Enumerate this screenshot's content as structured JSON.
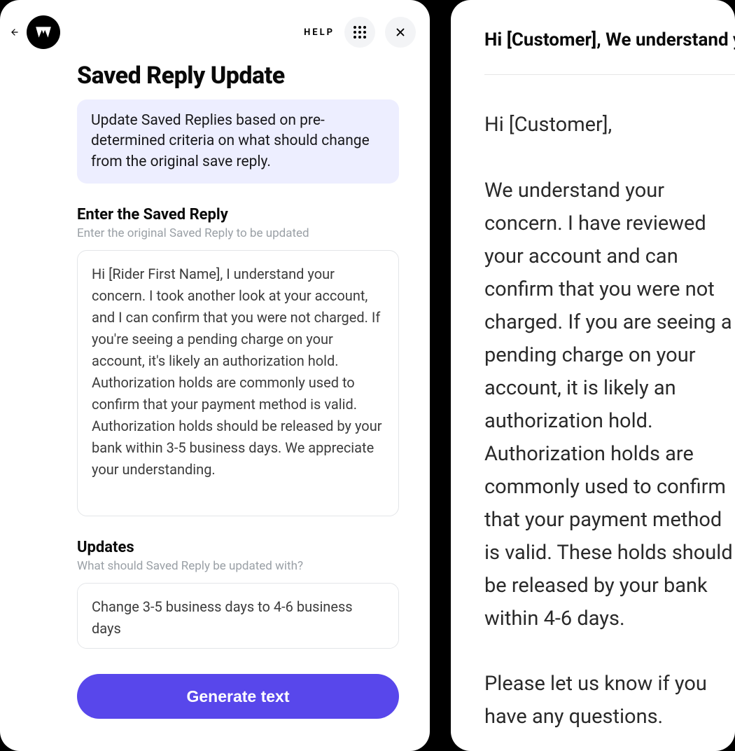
{
  "topbar": {
    "help_label": "HELP"
  },
  "page": {
    "title": "Saved Reply Update",
    "info_text": "Update Saved Replies based on pre-determined criteria on what should change from the original save reply."
  },
  "saved_reply_section": {
    "label": "Enter the Saved Reply",
    "sublabel": "Enter the original Saved Reply to be updated",
    "value": "Hi [Rider First Name], I understand your concern. I took another look at your account, and I can confirm that you were not charged. If you're seeing a pending charge on your account, it's likely an authorization hold. Authorization holds are commonly used to confirm that your payment method is valid. Authorization holds should be released by your bank within 3-5 business days. We appreciate your understanding."
  },
  "updates_section": {
    "label": "Updates",
    "sublabel": "What should Saved Reply be updated with?",
    "value": "Change 3-5 business days to 4-6 business days"
  },
  "actions": {
    "generate_label": "Generate text"
  },
  "preview": {
    "subject": "Hi [Customer], We understand your concern",
    "body": "Hi [Customer],\n\nWe understand your concern. I have reviewed your account and can confirm that you were not charged. If you are seeing a pending charge on your account, it is likely an authorization hold. Authorization holds are commonly used to confirm that your payment method is valid. These holds should be released by your bank within 4-6 days.\n\nPlease let us know if you have any questions."
  }
}
